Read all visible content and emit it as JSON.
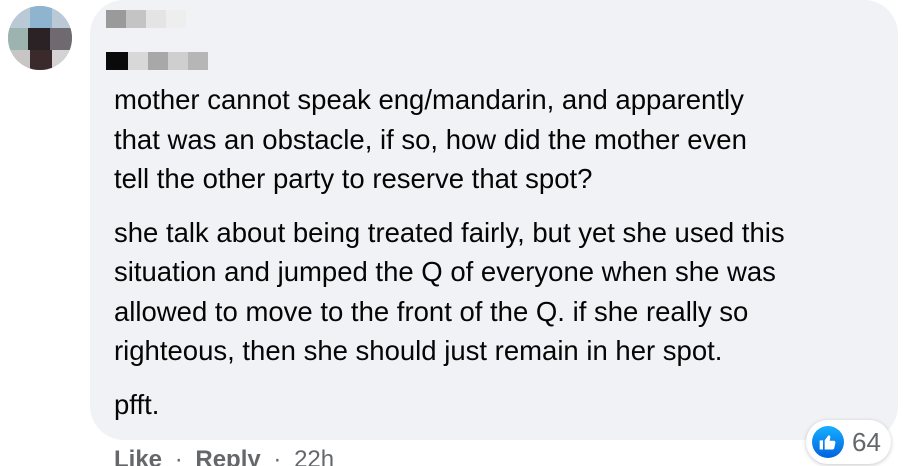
{
  "comment": {
    "paragraphs": [
      "mother cannot speak eng/mandarin, and apparently\nthat was an obstacle, if so, how did the mother even\ntell the other party to reserve that spot?",
      "she talk about being treated fairly, but yet she used this\nsituation and jumped the Q of everyone when she was\nallowed to move to the front of the Q. if she really so\nrighteous, then she should just remain in her spot.",
      "pfft."
    ]
  },
  "actions": {
    "like_label": "Like",
    "reply_label": "Reply",
    "separator": "·",
    "timestamp": "22h"
  },
  "reactions": {
    "icon": "thumbs-up-icon",
    "count": "64",
    "color": "#1877f2"
  }
}
